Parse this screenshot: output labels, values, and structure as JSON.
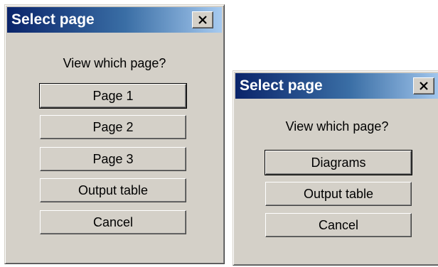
{
  "dialog_1": {
    "title": "Select page",
    "prompt": "View which page?",
    "buttons": [
      "Page 1",
      "Page 2",
      "Page 3",
      "Output table",
      "Cancel"
    ],
    "default_button": "Page 1",
    "close_icon": "close-x-icon"
  },
  "dialog_2": {
    "title": "Select page",
    "prompt": "View which page?",
    "buttons": [
      "Diagrams",
      "Output table",
      "Cancel"
    ],
    "default_button": "Diagrams",
    "close_icon": "close-x-icon"
  },
  "colors": {
    "dialog_face": "#d4d0c8",
    "titlebar_start": "#0a246a",
    "titlebar_end": "#a6caf0",
    "title_text": "#ffffff"
  }
}
